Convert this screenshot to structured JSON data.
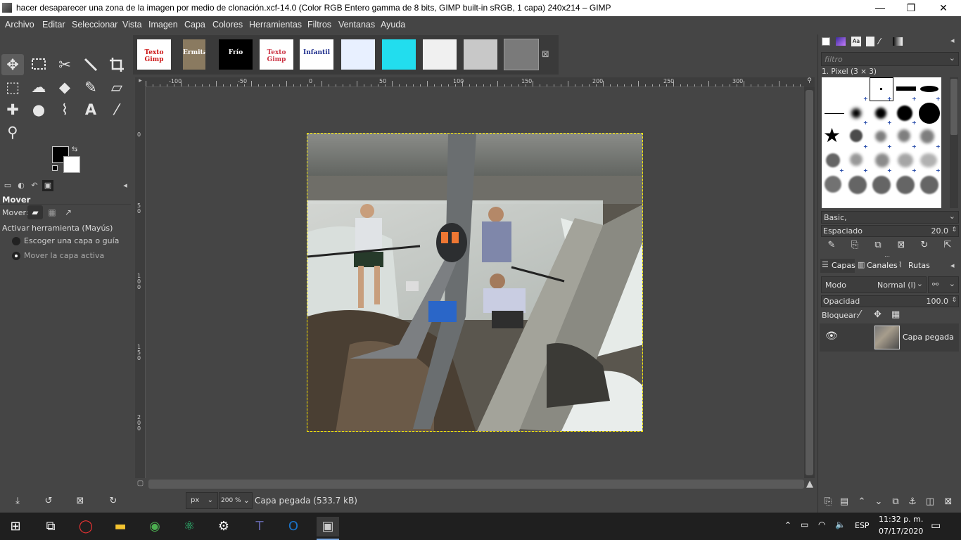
{
  "window": {
    "title": "hacer desaparecer una zona de la imagen por medio de clonación.xcf-14.0 (Color RGB Entero gamma de 8 bits, GIMP built-in sRGB, 1 capa) 240x214 – GIMP",
    "minimize": "—",
    "maximize": "❐",
    "close": "✕"
  },
  "menu": [
    "Archivo",
    "Editar",
    "Seleccionar",
    "Vista",
    "Imagen",
    "Capa",
    "Colores",
    "Herramientas",
    "Filtros",
    "Ventanas",
    "Ayuda"
  ],
  "image_tabs": [
    {
      "label": "Texto Gimp",
      "bg": "#ffffff",
      "fg": "#cc1111"
    },
    {
      "label": "Ermita",
      "bg": "#8a7a60",
      "fg": "#ffffff"
    },
    {
      "label": "Frío",
      "bg": "#000000",
      "fg": "#ffffff"
    },
    {
      "label": "Texto Gimp",
      "bg": "#ffffff",
      "fg": "#cc3344"
    },
    {
      "label": "Infantil",
      "bg": "#ffffff",
      "fg": "#1a2a8a"
    },
    {
      "label": "",
      "bg": "#e8f0ff",
      "fg": "#000"
    },
    {
      "label": "",
      "bg": "#22ddee",
      "fg": "#000"
    },
    {
      "label": "",
      "bg": "#f0f0f0",
      "fg": "#000"
    },
    {
      "label": "",
      "bg": "#c8c8c8",
      "fg": "#000"
    },
    {
      "label": "",
      "bg": "#7a7a7a",
      "fg": "#000"
    }
  ],
  "tab_close": "⊠",
  "ruler_h": [
    "-100",
    "-50",
    "0",
    "50",
    "100",
    "150",
    "200",
    "250",
    "300"
  ],
  "ruler_v": [
    "0",
    "5\n0",
    "1\n0\n0",
    "1\n5\n0",
    "2\n0\n0"
  ],
  "tool_options": {
    "title": "Mover",
    "mover_label": "Mover:",
    "activate": "Activar herramienta  (Mayús)",
    "option1": "Escoger una capa o guía",
    "option2": "Mover la capa activa"
  },
  "status": {
    "unit": "px",
    "zoom": "200 %",
    "info": "Capa pegada (533.7 kB)"
  },
  "brushes": {
    "filter_placeholder": "filtro",
    "selected_name": "1. Pixel (3 × 3)",
    "preset": "Basic,",
    "spacing_label": "Espaciado",
    "spacing_value": "20.0"
  },
  "layers_panel": {
    "tab_layers": "Capas",
    "tab_channels": "Canales",
    "tab_paths": "Rutas",
    "mode_label": "Modo",
    "mode_value": "Normal (l)",
    "opacity_label": "Opacidad",
    "opacity_value": "100.0",
    "lock_label": "Bloquear:",
    "layer_name": "Capa pegada"
  },
  "taskbar": {
    "language": "ESP",
    "time": "11:32 p. m.",
    "date": "07/17/2020"
  }
}
